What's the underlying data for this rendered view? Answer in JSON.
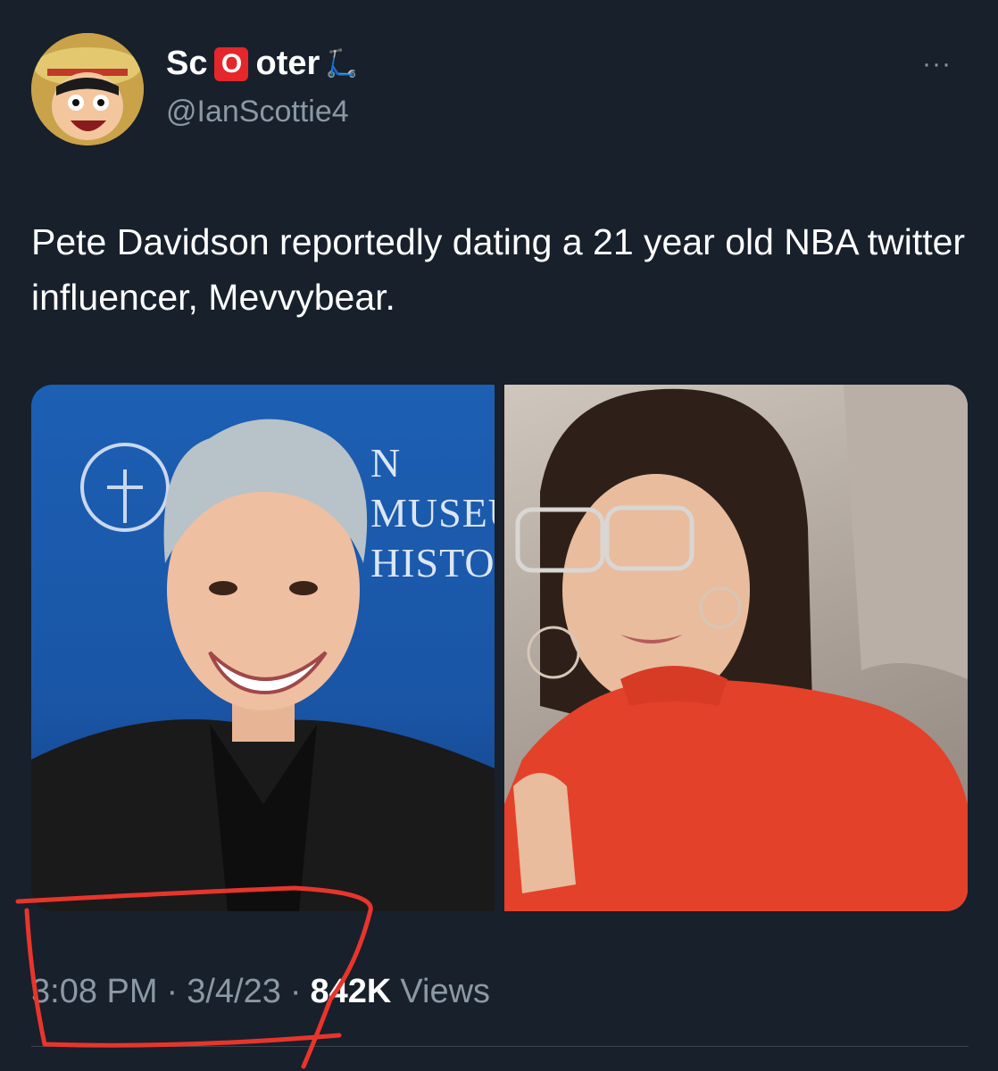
{
  "author": {
    "name_prefix": "Sc",
    "name_o": "O",
    "name_suffix": "oter",
    "scooter_icon": "🛴",
    "handle": "@IanScottie4",
    "avatar_icon": "anime-character-avatar"
  },
  "more_label": "···",
  "tweet": {
    "text": "Pete Davidson reportedly dating a 21 year old NBA twitter influencer, Mevvybear."
  },
  "media": {
    "left_backdrop_text_line1": "N MUSEU",
    "left_backdrop_text_line2": "HISTOI"
  },
  "meta": {
    "time": "3:08 PM",
    "sep1": "·",
    "date": "3/4/23",
    "sep2": "·",
    "views_count": "842K",
    "views_label": "Views"
  },
  "colors": {
    "background": "#17202b",
    "annotation_red": "#e8352c"
  }
}
